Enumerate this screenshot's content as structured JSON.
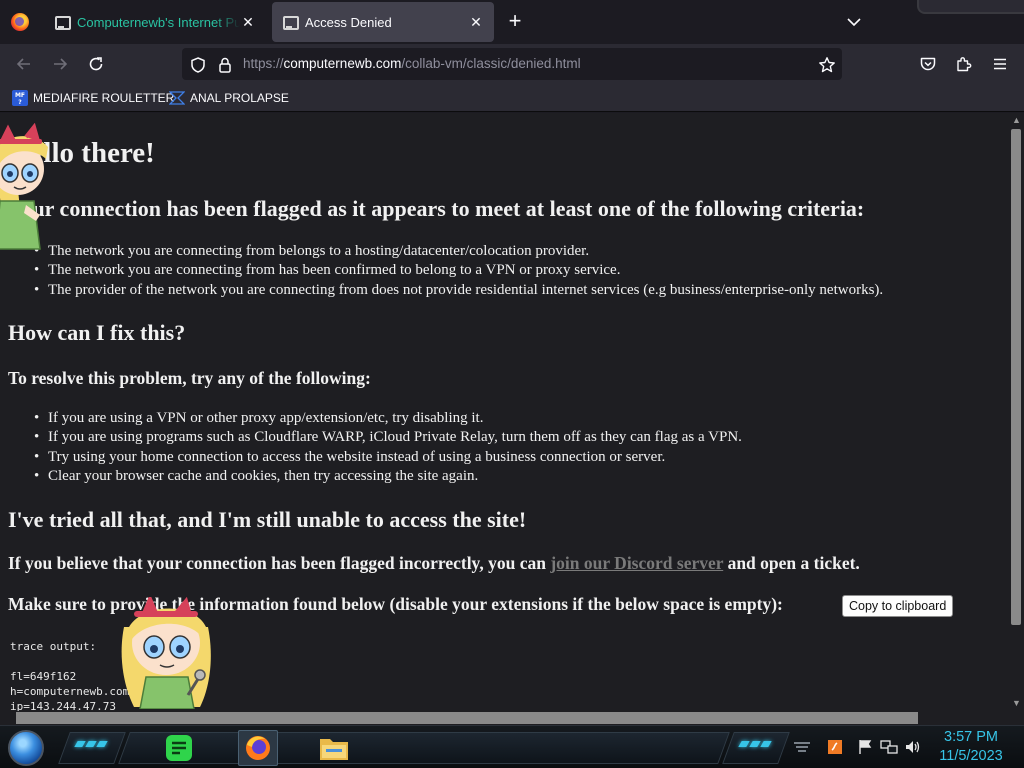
{
  "browser": {
    "tabs": [
      {
        "title": "Computernewb's Internet Pub",
        "close": "✕",
        "active": false
      },
      {
        "title": "Access Denied",
        "close": "✕",
        "active": true
      }
    ],
    "new_tab": "+",
    "url": {
      "prefix": "https://",
      "host": "computernewb.com",
      "path": "/collab-vm/classic/denied.html"
    },
    "bookmarks": [
      {
        "label": "MEDIAFIRE ROULETTER",
        "icon": "mediafire-icon"
      },
      {
        "label": "ANAL PROLAPSE",
        "icon": "bookmark-chevron-icon"
      }
    ]
  },
  "page": {
    "heading": "Hello there!",
    "flag_heading": "Your connection has been flagged as it appears to meet at least one of the following criteria:",
    "criteria": [
      "The network you are connecting from belongs to a hosting/datacenter/colocation provider.",
      "The network you are connecting from has been confirmed to belong to a VPN or proxy service.",
      "The provider of the network you are connecting from does not provide residential internet services (e.g business/enterprise-only networks)."
    ],
    "fix_heading": "How can I fix this?",
    "resolve_heading": "To resolve this problem, try any of the following:",
    "fixes": [
      "If you are using a VPN or other proxy app/extension/etc, try disabling it.",
      "If you are using programs such as Cloudflare WARP, iCloud Private Relay, turn them off as they can flag as a VPN.",
      "Try using your home connection to access the website instead of using a business connection or server.",
      "Clear your browser cache and cookies, then try accessing the site again."
    ],
    "tried_heading": "I've tried all that, and I'm still unable to access the site!",
    "incorrect_pre": "If you believe that your connection has been flagged incorrectly, you can ",
    "discord_link": "join our Discord server",
    "incorrect_post": " and open a ticket.",
    "provide_text": "Make sure to provide the information found below (disable your extensions if the below space is empty):",
    "copy_button": "Copy to clipboard",
    "trace_label": "trace output:",
    "trace_lines": [
      "fl=649f162",
      "h=computernewb.com",
      "ip=143.244.47.73"
    ]
  },
  "taskbar": {
    "apps": [
      "notes-app-icon",
      "firefox-icon",
      "file-explorer-icon"
    ],
    "time": "3:57 PM",
    "date": "11/5/2023"
  },
  "colors": {
    "accent": "#37c5e8",
    "tab_inactive_text": "#2ac3a2",
    "page_bg": "#1e1e22"
  }
}
